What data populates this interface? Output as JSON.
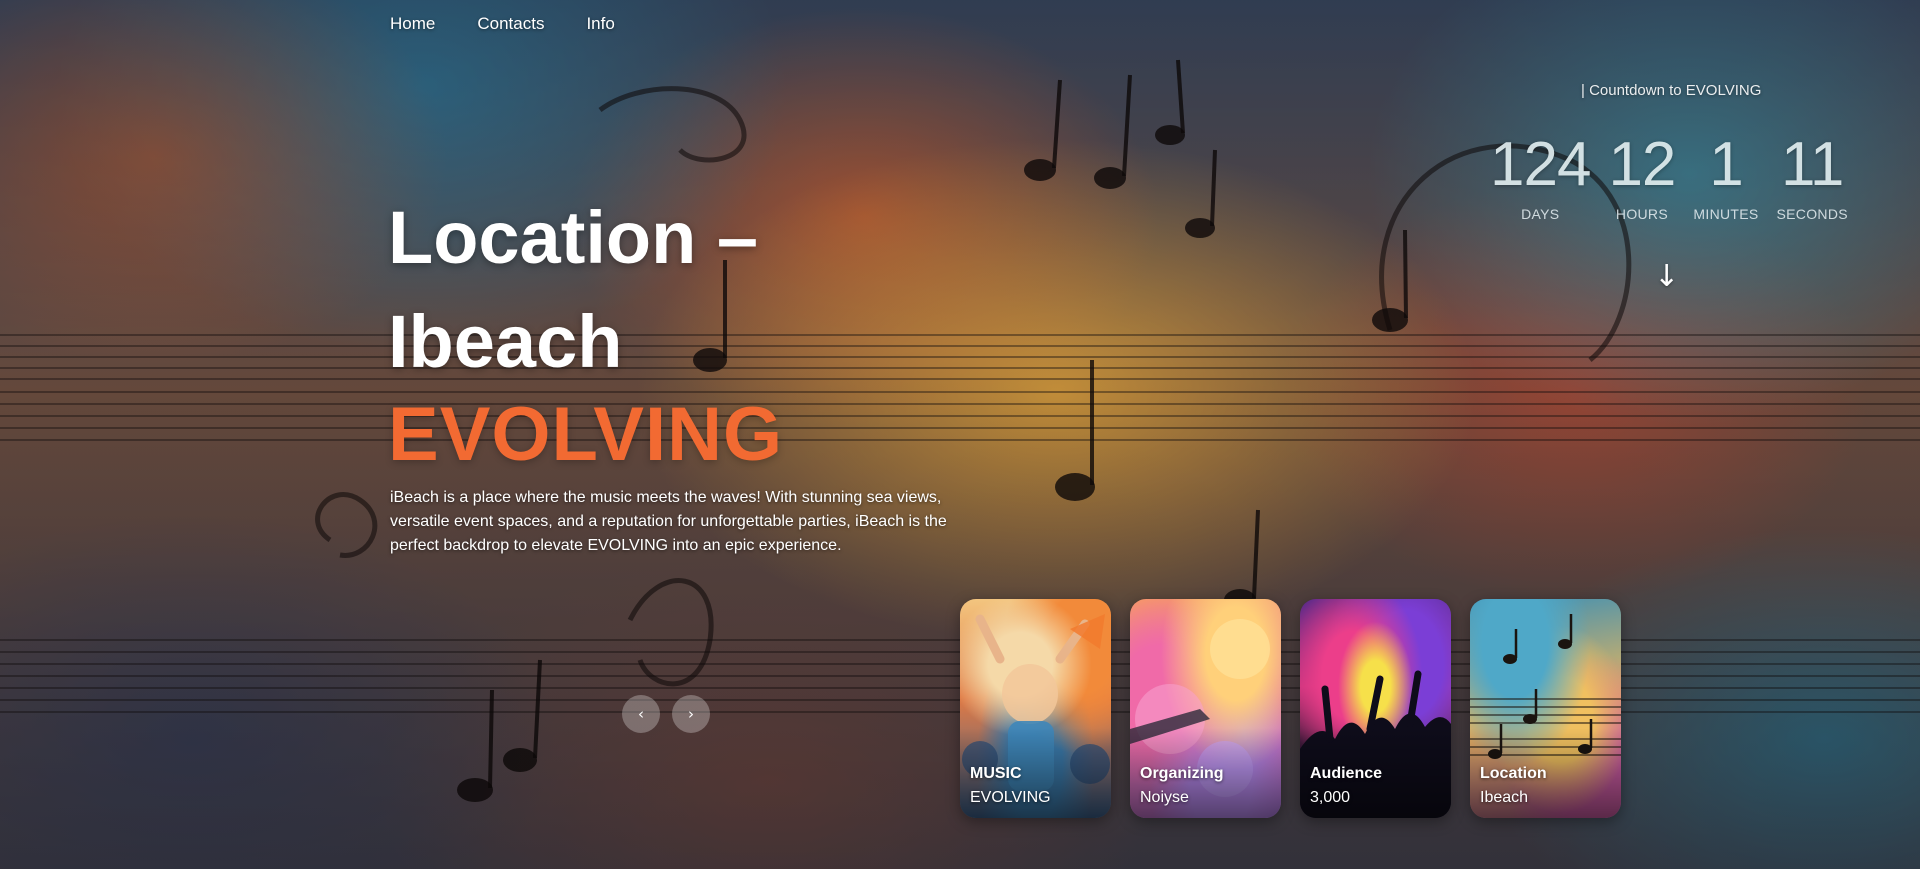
{
  "nav": {
    "items": [
      {
        "label": "Home"
      },
      {
        "label": "Contacts"
      },
      {
        "label": "Info"
      }
    ]
  },
  "hero": {
    "title_line1": "Location –",
    "title_line2": "Ibeach",
    "accent": "EVOLVING",
    "description": "iBeach is a place where the music meets the waves! With stunning sea views, versatile event spaces, and a reputation for unforgettable parties, iBeach is the perfect backdrop to elevate EVOLVING into an epic experience."
  },
  "slider": {
    "prev_icon": "‹",
    "next_icon": "›"
  },
  "countdown": {
    "label": "| Countdown to EVOLVING",
    "units": [
      {
        "value": "124",
        "label": "DAYS"
      },
      {
        "value": "12",
        "label": "HOURS"
      },
      {
        "value": "1",
        "label": "MINUTES"
      },
      {
        "value": "11",
        "label": "SECONDS"
      }
    ],
    "scroll_icon": "↓"
  },
  "cards": [
    {
      "title": "MUSIC",
      "value": "EVOLVING"
    },
    {
      "title": "Organizing",
      "value": "Noiyse"
    },
    {
      "title": "Audience",
      "value": "3,000"
    },
    {
      "title": "Location",
      "value": "Ibeach"
    }
  ],
  "colors": {
    "accent": "#f26a32",
    "text": "#ffffff"
  }
}
